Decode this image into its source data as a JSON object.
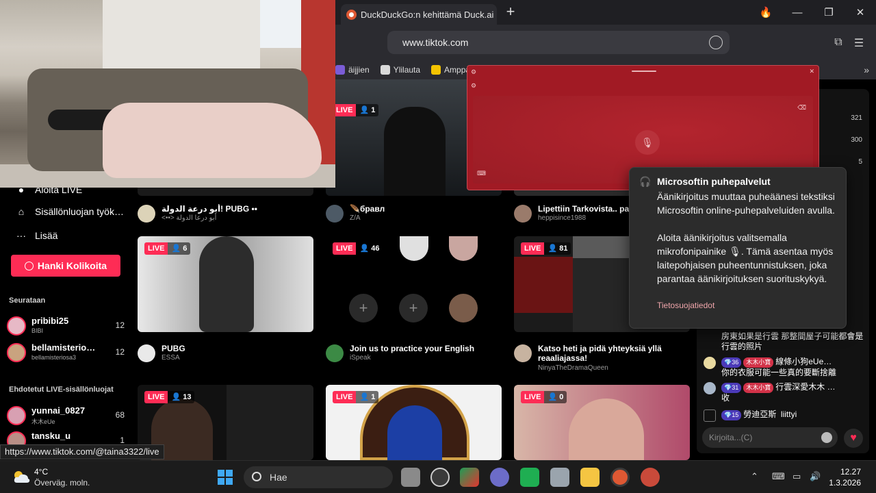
{
  "browser": {
    "tab_title": "DuckDuckGo:n kehittämä Duck.ai",
    "url": "www.tiktok.com",
    "bookmarks": [
      "äijjien",
      "Ylilauta",
      "Amppa"
    ]
  },
  "sidebar": {
    "nav": [
      "Aloita LIVE",
      "Sisällönluojan työk…",
      "Lisää"
    ],
    "coins_button": "Hanki Kolikoita",
    "following_title": "Seurataan",
    "following": [
      {
        "name": "pribibi25",
        "sub": "BIBI",
        "count": "12"
      },
      {
        "name": "bellamisterio…",
        "sub": "bellamisteriosa3",
        "count": "12"
      }
    ],
    "suggested_title": "Ehdotetut LIVE-sisällönluojat",
    "suggested": [
      {
        "name": "yunnai_0827",
        "sub": "木木eUe",
        "count": "68"
      },
      {
        "name": "tansku_u",
        "sub": "",
        "count": "1"
      }
    ]
  },
  "grid": {
    "row0_captions": [
      {
        "title": "أبو درعة الدولة! PUBG ••",
        "sub": "<••> أبو درعا الدولة"
      },
      {
        "title": "🪶бравл",
        "sub": "Z/A"
      },
      {
        "title": "Lipettiin Tarkovista.. part",
        "sub": "heppisince1988"
      }
    ],
    "row0_badges": [
      {
        "live": "LIVE",
        "viewers": "1"
      }
    ],
    "row1": [
      {
        "live": "LIVE",
        "viewers": "6",
        "title": "PUBG",
        "sub": "ESSA"
      },
      {
        "live": "LIVE",
        "viewers": "46",
        "title": "Join us to practice your English",
        "sub": "iSpeak"
      },
      {
        "live": "LIVE",
        "viewers": "81",
        "title": "Katso heti ja pidä yhteyksiä yllä reaaliajassa!",
        "sub": "NinyaTheDramaQueen"
      }
    ],
    "row2": [
      {
        "live": "LIVE",
        "viewers": "13"
      },
      {
        "live": "LIVE",
        "viewers": "1"
      },
      {
        "live": "LIVE",
        "viewers": "0"
      }
    ],
    "plus": "+"
  },
  "voice_tooltip": {
    "title": "Microsoftin puhepalvelut",
    "body1": "Äänikirjoitus muuttaa puheäänesi tekstiksi Microsoftin online-puhepalveluiden avulla.",
    "body2_a": "Aloita äänikirjoitus valitsemalla mikrofonipainike",
    "body2_b": ". Tämä asentaa myös laitepohjaisen puheentunnistuksen, joka parantaa äänikirjoituksen suorituskykyä.",
    "link": "Tietosuojatiedot"
  },
  "chat": {
    "counts": [
      "321",
      "300",
      "5"
    ],
    "messages": [
      {
        "text": "房東如果是行雲 那整間屋子可能都會是行雲的照片"
      },
      {
        "level": "36",
        "fan": "木木小寶",
        "name": "線條小狗eUe…",
        "text": "你的衣服可能一些真的要斷捨離"
      },
      {
        "level": "31",
        "fan": "木木小寶",
        "name": "行雲深愛木木 …",
        "text": "收"
      },
      {
        "level": "15",
        "name": "勞迪亞斯",
        "text": "liittyi"
      }
    ],
    "input_placeholder": "Kirjoita...(C)"
  },
  "status_url": "https://www.tiktok.com/@taina3322/live",
  "taskbar": {
    "temp": "4°C",
    "weather": "Överväg. moln.",
    "search": "Hae",
    "time": "12.27",
    "date": "1.3.2026"
  }
}
